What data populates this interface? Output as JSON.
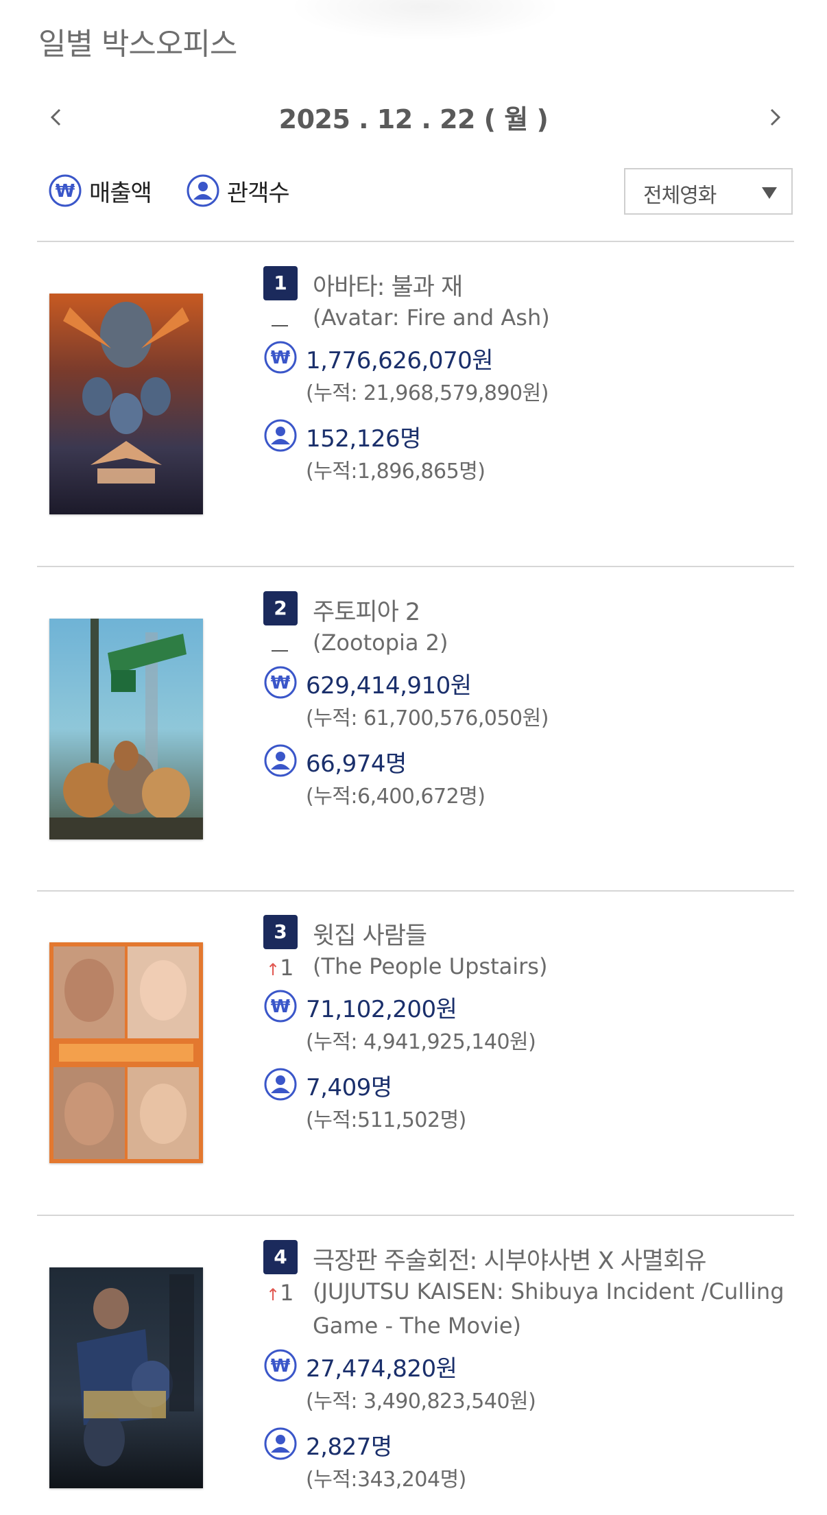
{
  "page": {
    "title": "일별 박스오피스"
  },
  "date_nav": {
    "date": "2025 . 12 . 22 ( 월 )"
  },
  "toggles": {
    "revenue_label": "매출액",
    "audience_label": "관객수"
  },
  "filter": {
    "selected": "전체영화"
  },
  "colors": {
    "accent": "#1b2a5c",
    "value_text": "#1a2f6b",
    "icon_blue": "#3a56c9",
    "rank_up": "#e0564f"
  },
  "movies": [
    {
      "rank": "1",
      "title_ko": "아바타: 불과 재",
      "rank_change": "",
      "title_en": "(Avatar: Fire and Ash)",
      "revenue": "1,776,626,070원",
      "revenue_total": "(누적: 21,968,579,890원)",
      "audience": "152,126명",
      "audience_total": "(누적:1,896,865명)"
    },
    {
      "rank": "2",
      "title_ko": "주토피아 2",
      "rank_change": "",
      "title_en": "(Zootopia 2)",
      "revenue": "629,414,910원",
      "revenue_total": "(누적: 61,700,576,050원)",
      "audience": "66,974명",
      "audience_total": "(누적:6,400,672명)"
    },
    {
      "rank": "3",
      "title_ko": "윗집 사람들",
      "rank_change": "1",
      "title_en": "(The People Upstairs)",
      "revenue": "71,102,200원",
      "revenue_total": "(누적: 4,941,925,140원)",
      "audience": "7,409명",
      "audience_total": "(누적:511,502명)"
    },
    {
      "rank": "4",
      "title_ko": "극장판 주술회전: 시부야사변 X 사멸회유",
      "rank_change": "1",
      "title_en": "(JUJUTSU KAISEN: Shibuya Incident /Culling Game - The Movie)",
      "revenue": "27,474,820원",
      "revenue_total": "(누적: 3,490,823,540원)",
      "audience": "2,827명",
      "audience_total": "(누적:343,204명)"
    }
  ]
}
